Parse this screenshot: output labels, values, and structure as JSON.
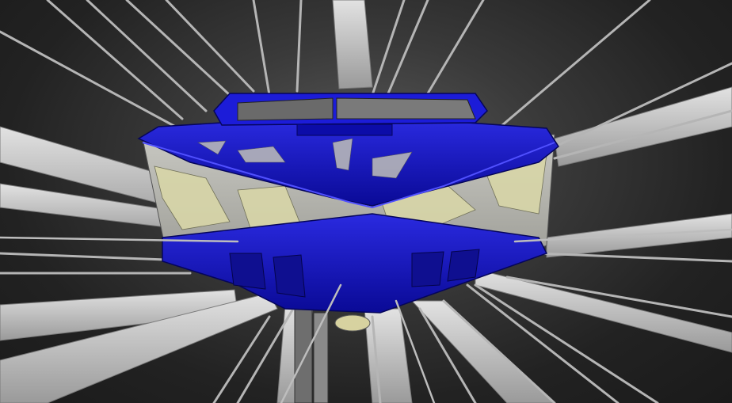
{
  "scene": {
    "kind": "3d-wireframe-render",
    "subject": "boat-hull",
    "colors": {
      "background_center": "#5a5a5a",
      "background_edge": "#1a1a1a",
      "beam": "#c9c9c9",
      "beam_dark": "#8f8f8f",
      "hull_blue": "#1010c8",
      "hull_blue_dark": "#0a0a8a",
      "glass": "#b9b9b0",
      "interior": "#d8d6a8"
    }
  }
}
